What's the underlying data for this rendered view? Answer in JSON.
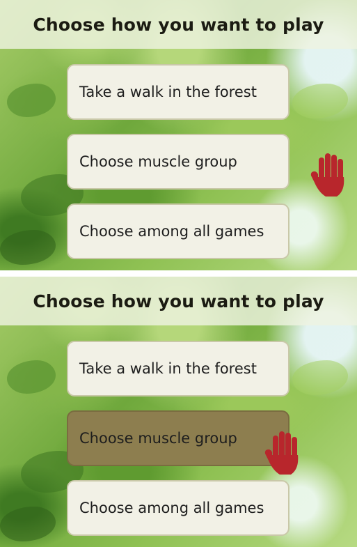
{
  "panels": [
    {
      "title": "Choose how you want to play",
      "options": [
        {
          "label": "Take a walk in the forest",
          "selected": false
        },
        {
          "label": "Choose muscle group",
          "selected": false
        },
        {
          "label": "Choose among all games",
          "selected": false
        }
      ],
      "cursor": {
        "icon": "hand-cursor-icon",
        "hovering": "none"
      }
    },
    {
      "title": "Choose how you want to play",
      "options": [
        {
          "label": "Take a walk in the forest",
          "selected": false
        },
        {
          "label": "Choose muscle group",
          "selected": true
        },
        {
          "label": "Choose among all games",
          "selected": false
        }
      ],
      "cursor": {
        "icon": "hand-cursor-icon",
        "hovering": "Choose muscle group"
      }
    }
  ],
  "colors": {
    "title_bar": "#eef3e0",
    "option_bg": "#f2f1e6",
    "option_selected_bg": "#8d7e4f",
    "hand": "#b8262c"
  }
}
